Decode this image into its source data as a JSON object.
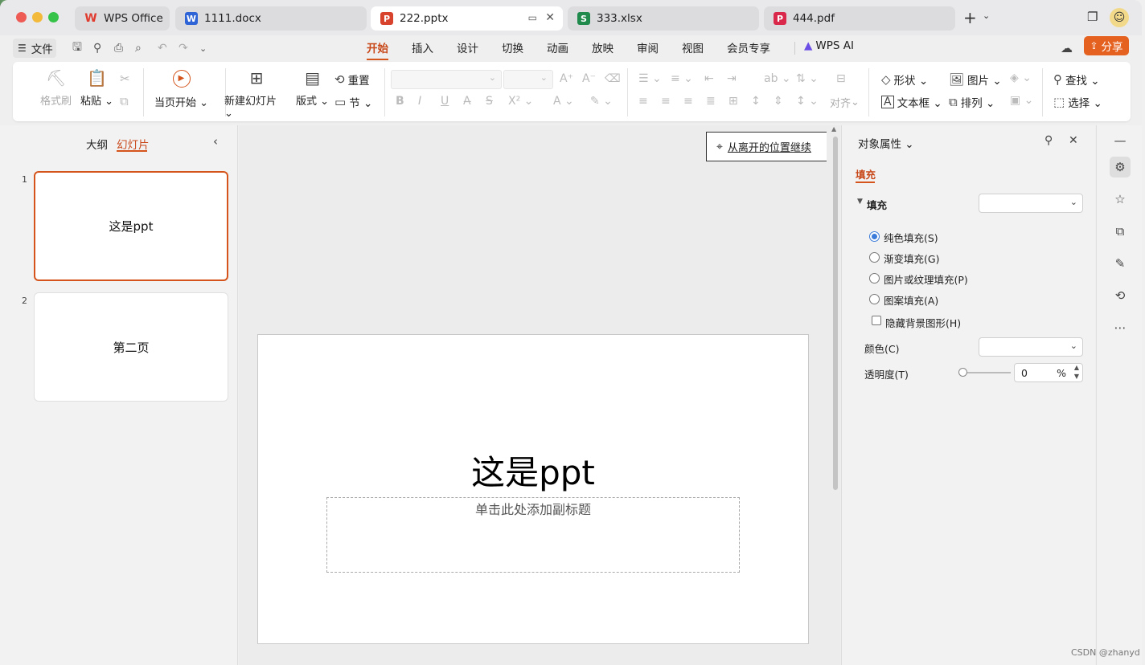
{
  "tabs": [
    {
      "label": "WPS Office",
      "icon": "W",
      "color": "#e03b2f"
    },
    {
      "label": "1111.docx",
      "icon": "W",
      "color": "#2e64d6"
    },
    {
      "label": "222.pptx",
      "icon": "P",
      "color": "#d8432d"
    },
    {
      "label": "333.xlsx",
      "icon": "S",
      "color": "#1f8a4c"
    },
    {
      "label": "444.pdf",
      "icon": "P",
      "color": "#d9284a"
    }
  ],
  "menubar": {
    "file": "文件",
    "items": [
      "开始",
      "插入",
      "设计",
      "切换",
      "动画",
      "放映",
      "审阅",
      "视图",
      "会员专享"
    ],
    "wps_ai": "WPS AI",
    "share": "分享"
  },
  "ribbon": {
    "format_painter": "格式刷",
    "paste": "粘贴",
    "from_current": "当页开始",
    "new_slide": "新建幻灯片",
    "layout": "版式",
    "reset": "重置",
    "section": "节",
    "align": "对齐",
    "shape": "形状",
    "picture": "图片",
    "textbox": "文本框",
    "arrange": "排列",
    "find": "查找",
    "select": "选择"
  },
  "left_panel": {
    "tab_outline": "大纲",
    "tab_slides": "幻灯片",
    "slides": [
      {
        "num": "1",
        "title": "这是ppt"
      },
      {
        "num": "2",
        "title": "第二页"
      }
    ]
  },
  "canvas": {
    "resume": "从离开的位置继续",
    "title": "这是ppt",
    "subtitle_placeholder": "单击此处添加副标题"
  },
  "right_panel": {
    "title": "对象属性",
    "tab": "填充",
    "section": "填充",
    "options": [
      "纯色填充(S)",
      "渐变填充(G)",
      "图片或纹理填充(P)",
      "图案填充(A)"
    ],
    "selected_index": 0,
    "hide_bg": "隐藏背景图形(H)",
    "color_label": "颜色(C)",
    "transparency_label": "透明度(T)",
    "transparency_value": "0",
    "percent": "%"
  },
  "watermark": "CSDN @zhanyd"
}
